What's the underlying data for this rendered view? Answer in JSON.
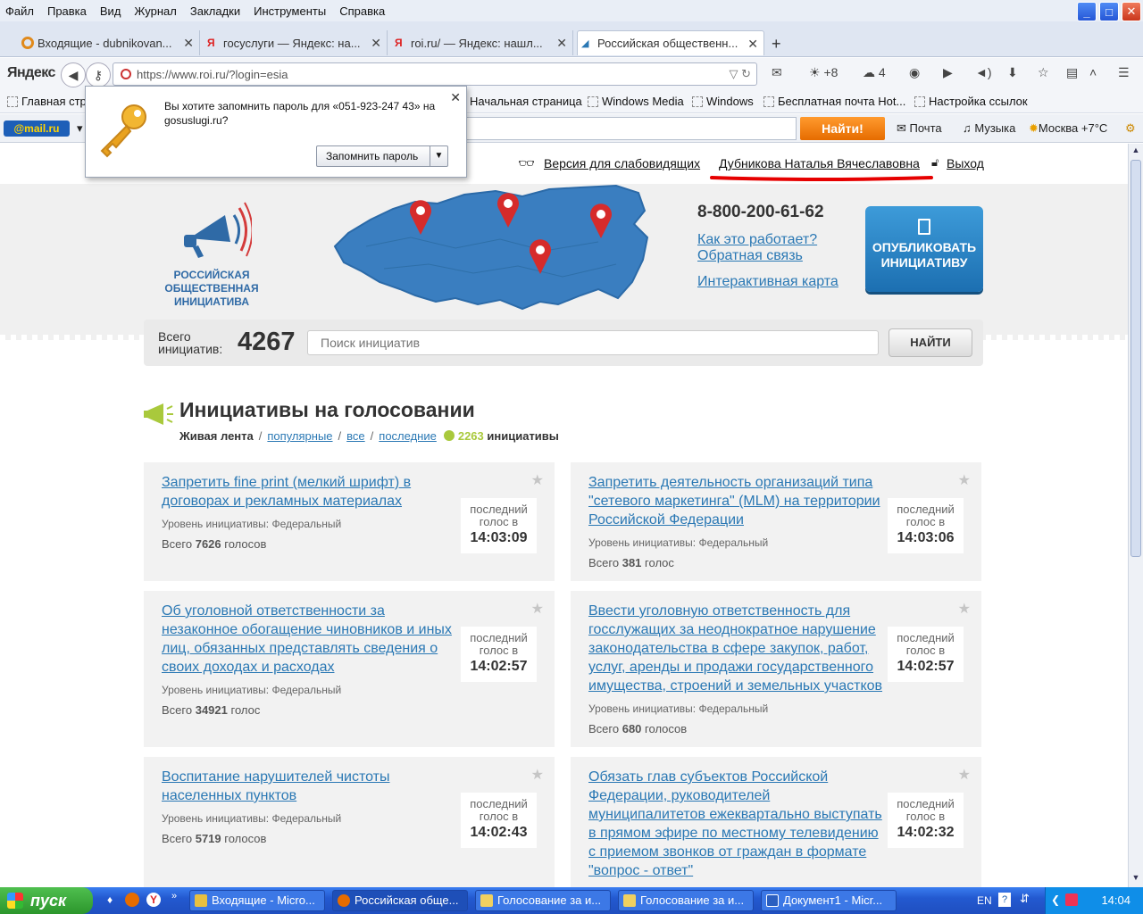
{
  "menu": [
    "Файл",
    "Правка",
    "Вид",
    "Журнал",
    "Закладки",
    "Инструменты",
    "Справка"
  ],
  "tabs": [
    {
      "label": "Входящие - dubnikovan...",
      "icon_color": "#e08a1c"
    },
    {
      "label": "госуслуги — Яндекс: на...",
      "icon_color": "#d22"
    },
    {
      "label": "roi.ru/ — Яндекс: нашл...",
      "icon_color": "#d22"
    },
    {
      "label": "Российская общественн...",
      "icon_color": "#2a78b4"
    }
  ],
  "nav": {
    "brand": "Яндекс",
    "url": "https://www.roi.ru/?login=esia",
    "weather_temp": "+8",
    "badge_count": "4"
  },
  "bookmarks": [
    "Главная стр",
    "Начальная страница",
    "Windows Media",
    "Windows",
    "Бесплатная почта Hot...",
    "Настройка ссылок"
  ],
  "mailbar": {
    "brand": "@mail.ru",
    "find": "Найти!",
    "mail": "Почта",
    "music": "Музыка",
    "weather": "Москва +7°C"
  },
  "password_prompt": {
    "message": "Вы хотите запомнить пароль для «051-923-247 43» на gosuslugi.ru?",
    "button": "Запомнить пароль"
  },
  "site": {
    "accessibility_link": "Версия для слабовидящих",
    "user_name": "Дубникова Наталья Вячеславовна",
    "logout": "Выход",
    "logo_text": "Российская общественная инициатива",
    "phone": "8-800-200-61-62",
    "how_it_works": "Как это работает?",
    "feedback": "Обратная связь",
    "interactive_map": "Интерактивная карта",
    "publish_button": "ОПУБЛИКОВАТЬ ИНИЦИАТИВУ",
    "total_label": "Всего инициатив:",
    "total_count": "4267",
    "search_placeholder": "Поиск инициатив",
    "search_button": "НАЙТИ",
    "section_title": "Инициативы на голосовании",
    "filter_live": "Живая лента",
    "filter_popular": "популярные",
    "filter_all": "все",
    "filter_recent": "последние",
    "active_count": "2263",
    "active_suffix": "инициативы"
  },
  "initiatives": [
    {
      "title": "Запретить fine print (мелкий шрифт) в договорах и рекламных материалах",
      "level": "Уровень инициативы: Федеральный",
      "votes_prefix": "Всего",
      "votes": "7626",
      "votes_suffix": "голосов",
      "last_label": "последний голос в",
      "last_time": "14:03:09"
    },
    {
      "title": "Запретить деятельность организаций типа \"сетевого маркетинга\" (MLM) на территории Российской Федерации",
      "level": "Уровень инициативы: Федеральный",
      "votes_prefix": "Всего",
      "votes": "381",
      "votes_suffix": "голос",
      "last_label": "последний голос в",
      "last_time": "14:03:06"
    },
    {
      "title": "Об уголовной ответственности за незаконное обогащение чиновников и иных лиц, обязанных представлять сведения о своих доходах и расходах",
      "level": "Уровень инициативы: Федеральный",
      "votes_prefix": "Всего",
      "votes": "34921",
      "votes_suffix": "голос",
      "last_label": "последний голос в",
      "last_time": "14:02:57"
    },
    {
      "title": "Ввести уголовную ответственность для госслужащих за неоднократное нарушение законодательства в сфере закупок, работ, услуг, аренды и продажи государственного имущества, строений и земельных участков",
      "level": "Уровень инициативы: Федеральный",
      "votes_prefix": "Всего",
      "votes": "680",
      "votes_suffix": "голосов",
      "last_label": "последний голос в",
      "last_time": "14:02:57"
    },
    {
      "title": "Воспитание нарушителей чистоты населенных пунктов",
      "level": "Уровень инициативы: Федеральный",
      "votes_prefix": "Всего",
      "votes": "5719",
      "votes_suffix": "голосов",
      "last_label": "последний голос в",
      "last_time": "14:02:43"
    },
    {
      "title": "Обязать глав субъектов Российской Федерации, руководителей муниципалитетов ежеквартально выступать в прямом эфире по местному телевидению с приемом звонков от граждан в формате \"вопрос - ответ\"",
      "level": "",
      "votes_prefix": "",
      "votes": "",
      "votes_suffix": "",
      "last_label": "последний голос в",
      "last_time": "14:02:32"
    }
  ],
  "taskbar": {
    "start": "пуск",
    "items": [
      "Входящие - Micro...",
      "Российская обще...",
      "Голосование за и...",
      "Голосование за и...",
      "Документ1 - Micr..."
    ],
    "lang": "EN",
    "clock": "14:04"
  },
  "colors": {
    "accent": "#2a78b4",
    "publish": "#1c6fb1",
    "mail_find": "#f08010",
    "taskbar": "#2359d0"
  }
}
